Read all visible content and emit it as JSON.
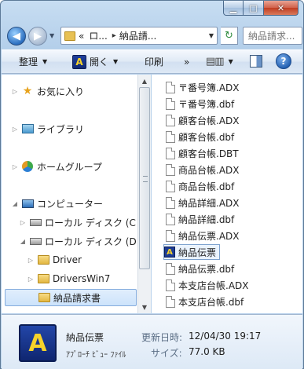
{
  "window": {
    "caption_min": "▁",
    "caption_max": "□",
    "caption_close": "✕"
  },
  "address": {
    "seg1": "«",
    "seg2": "ロ...",
    "seg3": "納品請...",
    "sep": "▸",
    "search_placeholder": "納品請求..."
  },
  "commandbar": {
    "organize": "整理",
    "open": "開く",
    "print": "印刷",
    "view_icon": "view-options-icon",
    "app_icon_letter": "A",
    "help": "?"
  },
  "navpane": {
    "favorites": "お気に入り",
    "libraries": "ライブラリ",
    "homegroup": "ホームグループ",
    "computer": "コンピューター",
    "disk_c": "ローカル ディスク (C",
    "disk_d": "ローカル ディスク (D",
    "folder_driver": "Driver",
    "folder_driverswin7": "DriversWin7",
    "folder_selected": "納品請求書"
  },
  "files": [
    "〒番号簿.ADX",
    "〒番号簿.dbf",
    "顧客台帳.ADX",
    "顧客台帳.dbf",
    "顧客台帳.DBT",
    "商品台帳.ADX",
    "商品台帳.dbf",
    "納品詳細.ADX",
    "納品詳細.dbf",
    "納品伝票.ADX",
    "納品伝票",
    "納品伝票.dbf",
    "本支店台帳.ADX",
    "本支店台帳.dbf"
  ],
  "details": {
    "icon_letter": "A",
    "name": "納品伝票",
    "type": "ｱﾌﾟﾛｰﾁ ﾋﾞｭｰ ﾌｧｲﾙ",
    "modified_label": "更新日時:",
    "modified_value": "12/04/30 19:17",
    "size_label": "サイズ:",
    "size_value": "77.0 KB"
  }
}
